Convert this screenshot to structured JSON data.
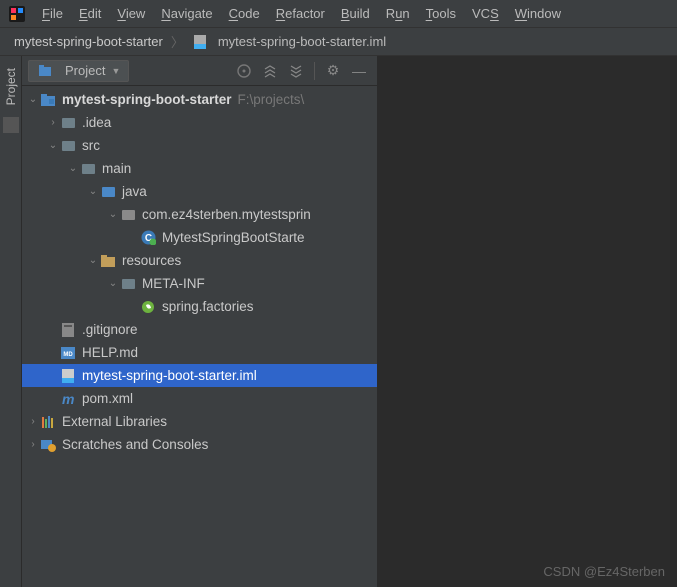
{
  "menubar": {
    "items": [
      "File",
      "Edit",
      "View",
      "Navigate",
      "Code",
      "Refactor",
      "Build",
      "Run",
      "Tools",
      "VCS",
      "Window"
    ]
  },
  "breadcrumb": {
    "root": "mytest-spring-boot-starter",
    "file": "mytest-spring-boot-starter.iml"
  },
  "panel": {
    "title": "Project"
  },
  "sidebar": {
    "tab": "Project"
  },
  "tree": {
    "root": {
      "label": "mytest-spring-boot-starter",
      "path": "F:\\projects\\"
    },
    "idea": ".idea",
    "src": "src",
    "main": "main",
    "java": "java",
    "pkg": "com.ez4sterben.mytestsprin",
    "cls": "MytestSpringBootStarte",
    "resources": "resources",
    "metainf": "META-INF",
    "factories": "spring.factories",
    "gitignore": ".gitignore",
    "helpmd": "HELP.md",
    "iml": "mytest-spring-boot-starter.iml",
    "pom": "pom.xml",
    "extlib": "External Libraries",
    "scratch": "Scratches and Consoles"
  },
  "watermark": "CSDN @Ez4Sterben"
}
